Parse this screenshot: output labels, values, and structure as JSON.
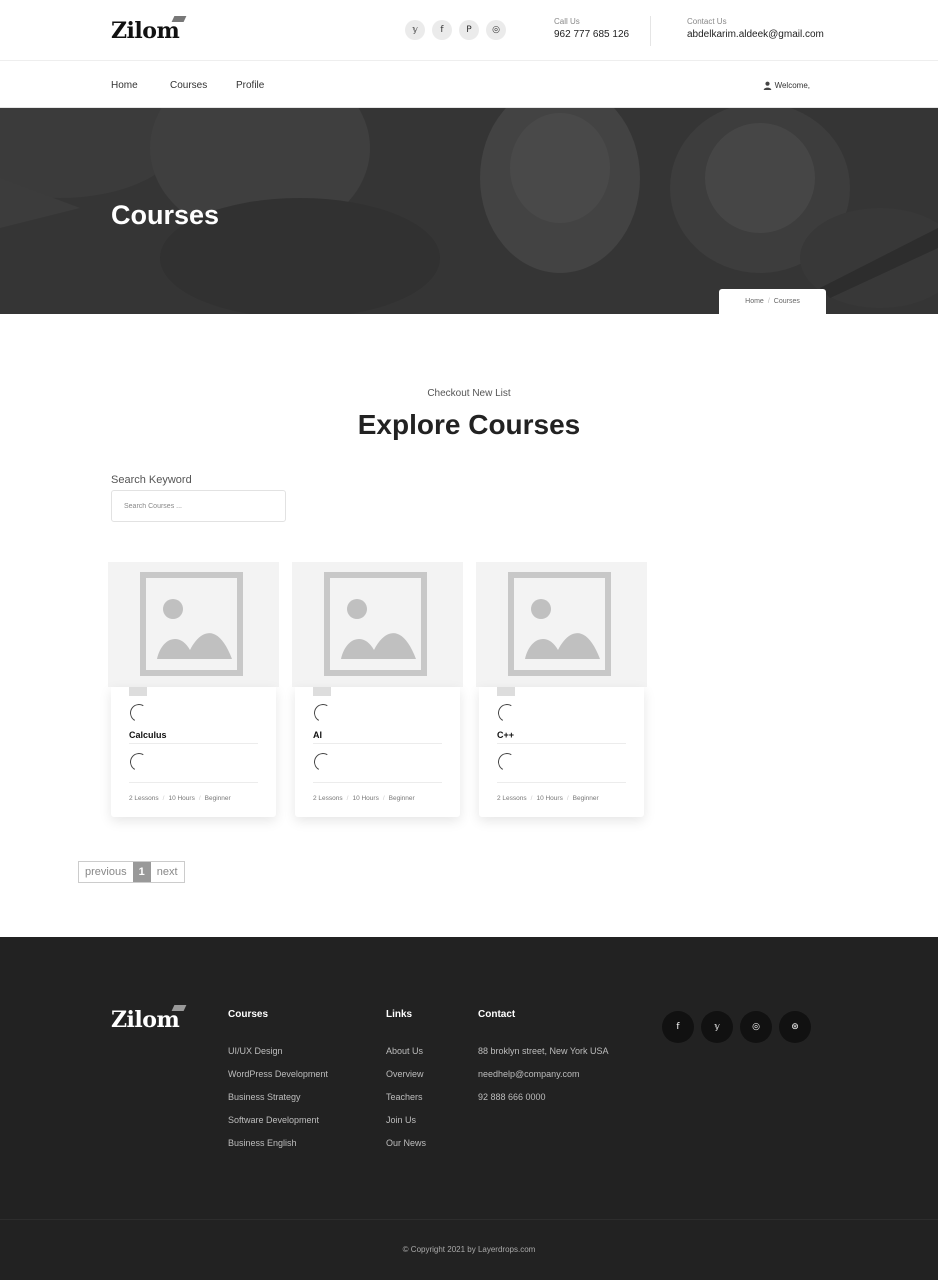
{
  "brand": {
    "logo_text": "Zilom"
  },
  "header": {
    "social_icons": [
      "twitter-icon",
      "facebook-icon",
      "pinterest-icon",
      "instagram-icon"
    ],
    "social_glyphs": [
      "𝕪",
      "f",
      "P",
      "◎"
    ],
    "call_label": "Call Us",
    "call_value": "962 777 685 126",
    "contact_label": "Contact Us",
    "contact_value": "abdelkarim.aldeek@gmail.com"
  },
  "nav": {
    "items": [
      "Home",
      "Courses",
      "Profile"
    ],
    "welcome": "Welcome,"
  },
  "hero": {
    "title": "Courses",
    "breadcrumb": [
      "Home",
      "Courses"
    ]
  },
  "section": {
    "eyebrow": "Checkout New List",
    "title": "Explore Courses"
  },
  "search": {
    "label": "Search Keyword",
    "placeholder": "Search Courses ..."
  },
  "courses": [
    {
      "name": "Calculus",
      "lessons": "2 Lessons",
      "hours": "10 Hours",
      "level": "Beginner"
    },
    {
      "name": "AI",
      "lessons": "2 Lessons",
      "hours": "10 Hours",
      "level": "Beginner"
    },
    {
      "name": "C++",
      "lessons": "2 Lessons",
      "hours": "10 Hours",
      "level": "Beginner"
    }
  ],
  "pagination": {
    "previous": "previous",
    "current": "1",
    "next": "next"
  },
  "footer": {
    "logo_text": "Zilom",
    "courses_title": "Courses",
    "courses_links": [
      "UI/UX Design",
      "WordPress Development",
      "Business Strategy",
      "Software Development",
      "Business English"
    ],
    "links_title": "Links",
    "links": [
      "About Us",
      "Overview",
      "Teachers",
      "Join Us",
      "Our News"
    ],
    "contact_title": "Contact",
    "contact_lines": [
      "88 broklyn street, New York USA",
      "needhelp@company.com",
      "92 888 666 0000"
    ],
    "social_icons": [
      "facebook-icon",
      "twitter-icon",
      "instagram-icon",
      "dribbble-icon"
    ],
    "social_glyphs": [
      "f",
      "𝕪",
      "◎",
      "⊛"
    ],
    "copyright": "© Copyright 2021 by Layerdrops.com"
  },
  "colors": {
    "footer_bg": "#222222",
    "hero_overlay": "#3a3a3a",
    "accent": "#999999"
  }
}
